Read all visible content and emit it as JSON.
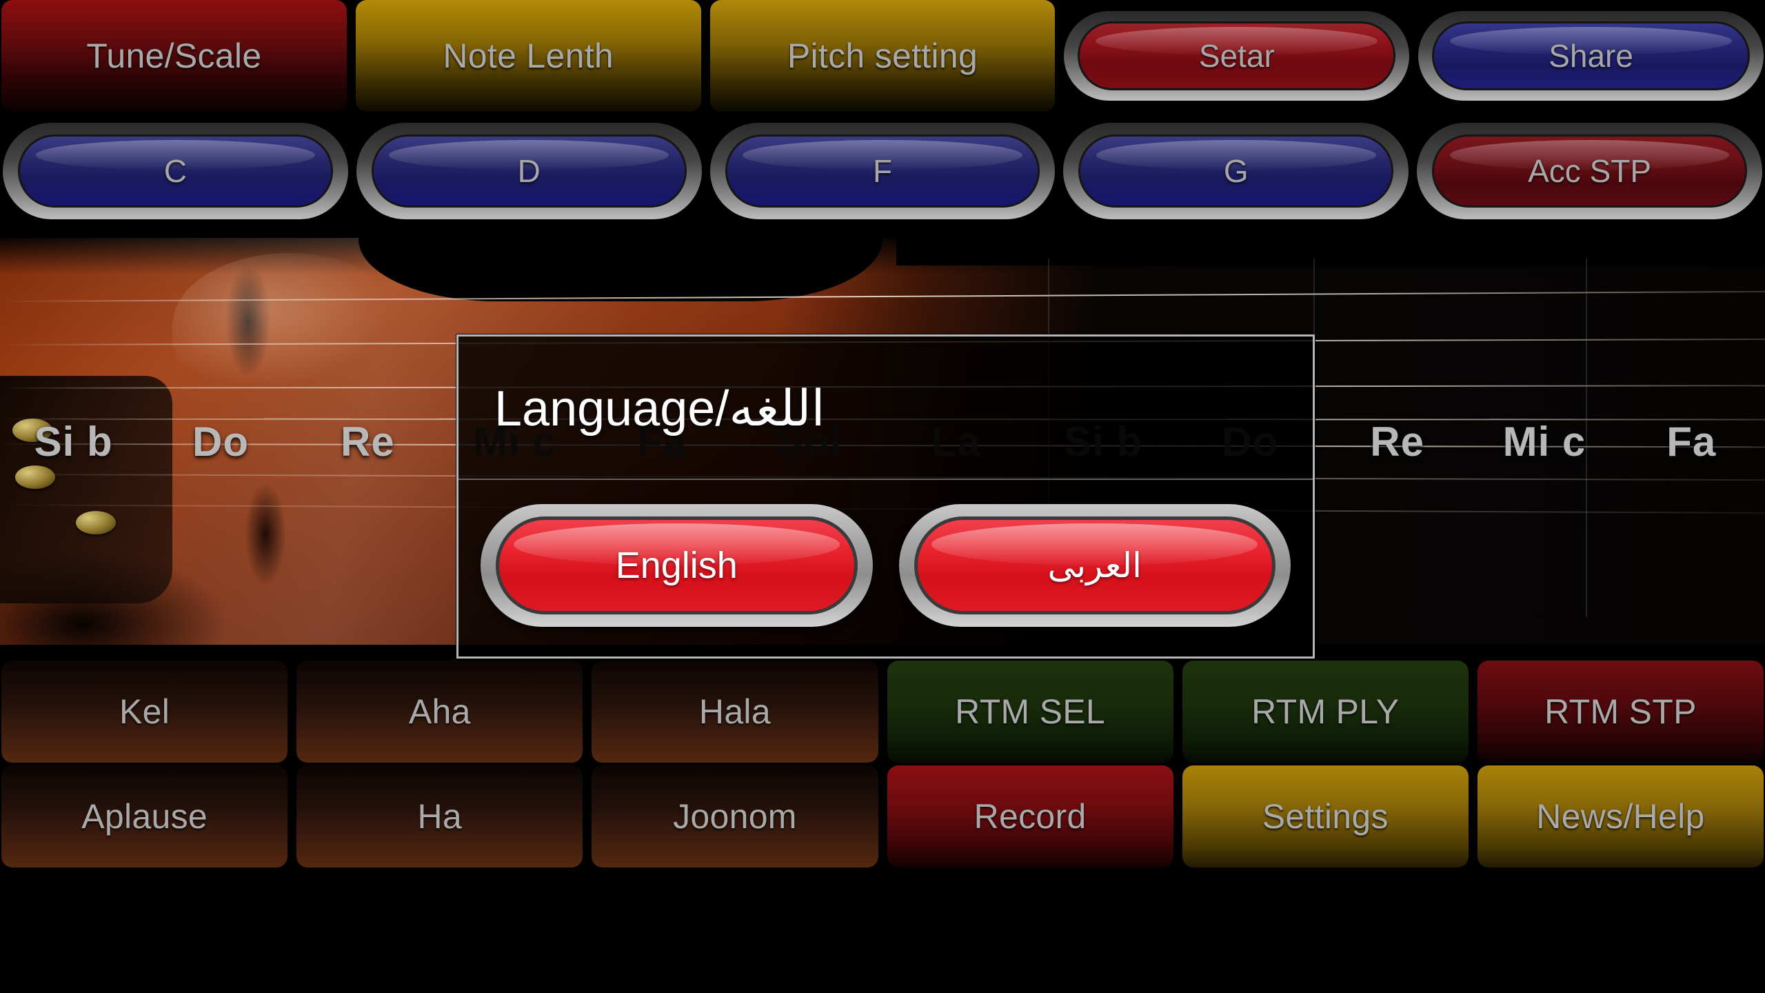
{
  "app": {
    "background_color": "#000000"
  },
  "top_row": {
    "buttons": [
      {
        "label": "Tune/Scale",
        "style": "flat-red",
        "kind": "flat"
      },
      {
        "label": "Note Lenth",
        "style": "flat-gold",
        "kind": "flat"
      },
      {
        "label": "Pitch setting",
        "style": "flat-gold2",
        "kind": "flat"
      },
      {
        "label": "Setar",
        "style": "pill-red",
        "kind": "pill"
      },
      {
        "label": "Share",
        "style": "pill-navy",
        "kind": "pill"
      }
    ]
  },
  "note_row": {
    "buttons": [
      {
        "label": "C",
        "style": "pill-blue"
      },
      {
        "label": "D",
        "style": "pill-blue"
      },
      {
        "label": "F",
        "style": "pill-blue"
      },
      {
        "label": "G",
        "style": "pill-blue"
      },
      {
        "label": "Acc STP",
        "style": "pill-redd"
      }
    ]
  },
  "fingerboard": {
    "notes": [
      {
        "label": "Si b",
        "state": "bright"
      },
      {
        "label": "Do",
        "state": "bright"
      },
      {
        "label": "Re",
        "state": "bright"
      },
      {
        "label": "Mi c",
        "state": "dim"
      },
      {
        "label": "Fa",
        "state": "dim"
      },
      {
        "label": "Sol",
        "state": "dim"
      },
      {
        "label": "La",
        "state": "dim"
      },
      {
        "label": "Si b",
        "state": "dim"
      },
      {
        "label": "Do",
        "state": "dim"
      },
      {
        "label": "Re",
        "state": "bright"
      },
      {
        "label": "Mi c",
        "state": "bright"
      },
      {
        "label": "Fa",
        "state": "bright"
      }
    ]
  },
  "bottom_row_1": {
    "buttons": [
      {
        "label": "Kel",
        "style": "flat-brown"
      },
      {
        "label": "Aha",
        "style": "flat-brown"
      },
      {
        "label": "Hala",
        "style": "flat-brown"
      },
      {
        "label": "RTM SEL",
        "style": "flat-green"
      },
      {
        "label": "RTM PLY",
        "style": "flat-green"
      },
      {
        "label": "RTM STP",
        "style": "flat-darkred"
      }
    ]
  },
  "bottom_row_2": {
    "buttons": [
      {
        "label": "Aplause",
        "style": "flat-brown"
      },
      {
        "label": "Ha",
        "style": "flat-brown"
      },
      {
        "label": "Joonom",
        "style": "flat-brown"
      },
      {
        "label": "Record",
        "style": "flat-red2"
      },
      {
        "label": "Settings",
        "style": "flat-gold3"
      },
      {
        "label": "News/Help",
        "style": "flat-gold3"
      }
    ]
  },
  "dialog": {
    "title": "Language/اللغه",
    "buttons": [
      {
        "label": "English",
        "dir": "ltr"
      },
      {
        "label": "العربى",
        "dir": "rtl"
      }
    ]
  },
  "colors": {
    "accent_red": "#e8242f",
    "pill_blue": "#22226e",
    "gold": "#b38b06",
    "dialog_border": "#b6b6b6",
    "label_gray": "#a9a9a9"
  }
}
